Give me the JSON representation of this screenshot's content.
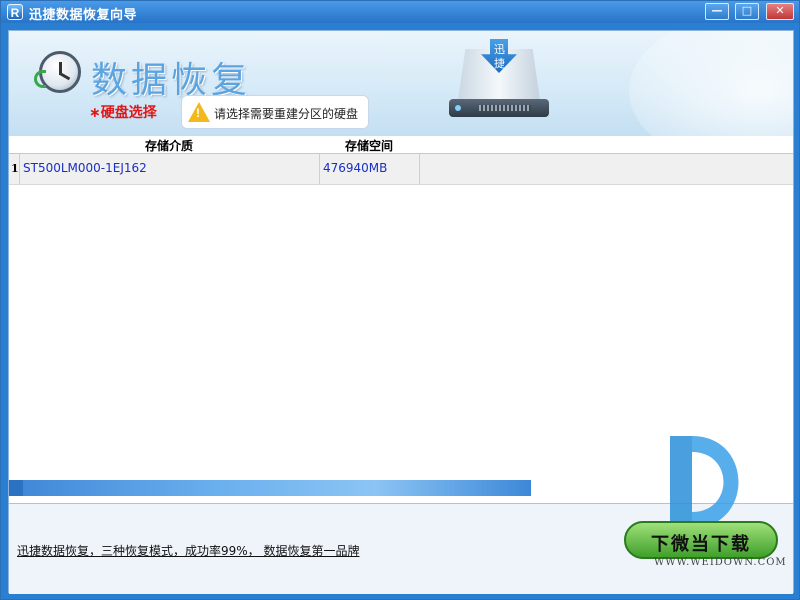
{
  "window": {
    "title": "迅捷数据恢复向导",
    "app_icon_letter": "R",
    "controls": {
      "minimize": "—",
      "maximize": "□",
      "close": "✕"
    }
  },
  "header": {
    "title": "数据恢复",
    "step_label": "∗硬盘选择",
    "tip": "请选择需要重建分区的硬盘",
    "drive_chars": [
      "迅",
      "捷"
    ],
    "icons": [
      "clock-restore-icon",
      "warning-icon",
      "hard-drive-download-icon"
    ]
  },
  "table": {
    "columns": [
      "存储介质",
      "存储空间"
    ],
    "rows": [
      {
        "index": "1",
        "medium": "ST500LM000-1EJ162",
        "size": "476940MB"
      }
    ]
  },
  "footer": {
    "link": "迅捷数据恢复，三种恢复模式，成功率99%， 数据恢复第一品牌"
  },
  "watermark": {
    "button": "下微当下载",
    "site": "WWW.WEIDOWN.COM"
  },
  "colors": {
    "title_bar": "#2b7fd3",
    "header_title": "#5ba4e0",
    "step_label": "#e01818",
    "cell_text": "#1a2fc8",
    "progress": "#4a9ae0"
  }
}
